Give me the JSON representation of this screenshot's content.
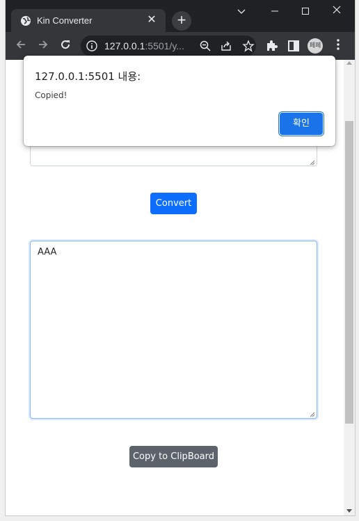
{
  "browser": {
    "tab_title": "Kin Converter",
    "new_tab_label": "+",
    "url_host": "127.0.0.1",
    "url_rest": ":5501/y...",
    "profile_initials": "페페",
    "colors": {
      "frame": "#202124",
      "toolbar": "#35363a",
      "accent": "#1a73e8"
    }
  },
  "page": {
    "input_value": "",
    "convert_label": "Convert",
    "output_value": "AAA",
    "copy_label": "Copy to ClipBoard",
    "colors": {
      "primary": "#0d6efd",
      "secondary": "#5c636a"
    }
  },
  "dialog": {
    "title": "127.0.0.1:5501 내용:",
    "message": "Copied!",
    "ok_label": "확인"
  }
}
